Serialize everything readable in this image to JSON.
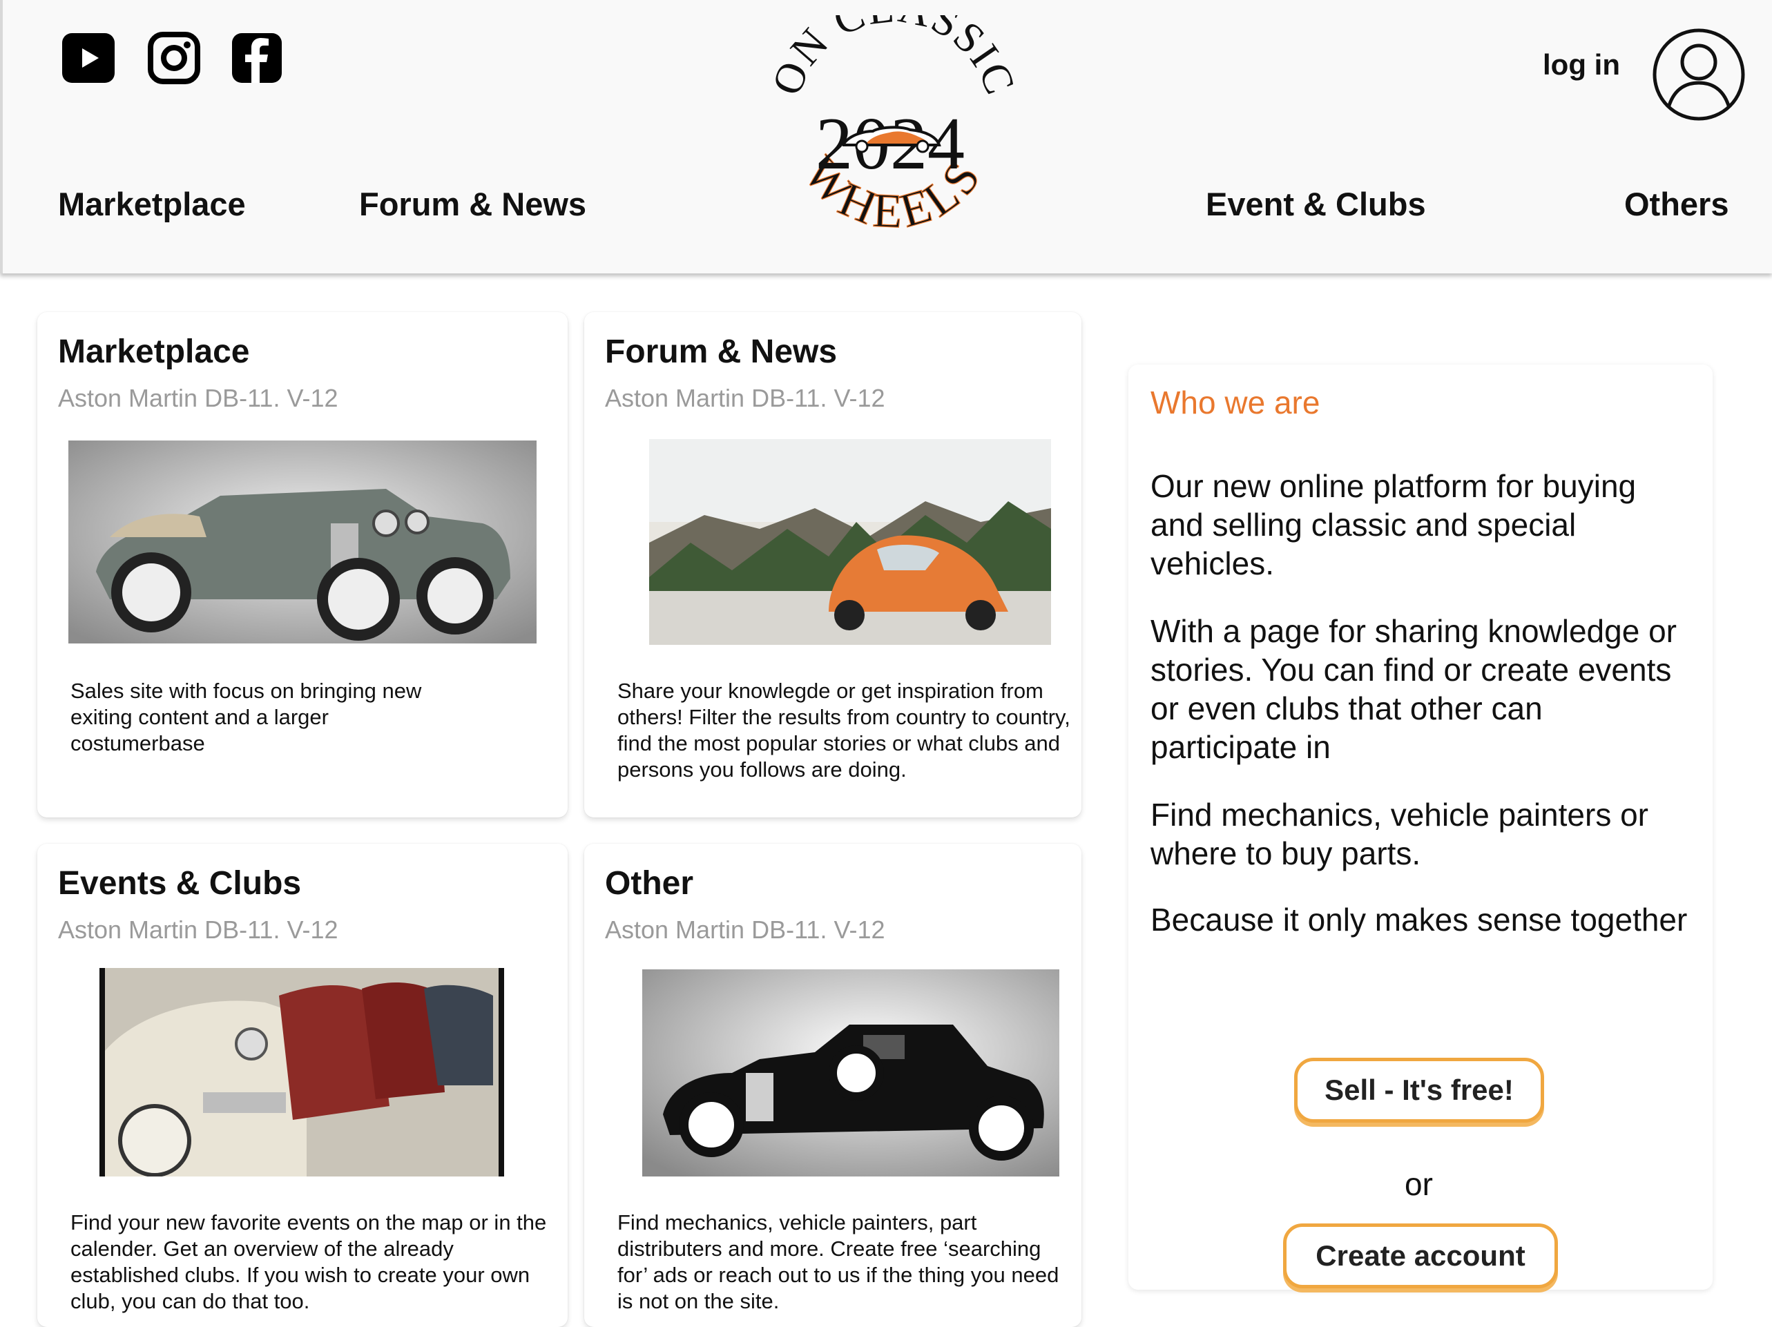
{
  "header": {
    "social": [
      {
        "icon": "youtube-icon"
      },
      {
        "icon": "instagram-icon"
      },
      {
        "icon": "facebook-icon"
      }
    ],
    "logo": {
      "top_text": "ON CLASSIC",
      "year": "2024",
      "bottom_text": "WHEELS"
    },
    "login_label": "log in",
    "nav": {
      "marketplace": "Marketplace",
      "forum": "Forum & News",
      "events": "Event & Clubs",
      "others": "Others"
    }
  },
  "cards": [
    {
      "title": "Marketplace",
      "subtitle": "Aston Martin DB-11. V-12",
      "description": "Sales site with focus on bringing new exiting content and a larger costumerbase"
    },
    {
      "title": "Forum & News",
      "subtitle": "Aston Martin DB-11. V-12",
      "description": "Share your knowlegde or get inspiration from others! Filter the results from country to country, find the most popular stories or what clubs and persons you follows are doing."
    },
    {
      "title": "Events & Clubs",
      "subtitle": "Aston Martin DB-11. V-12",
      "description": "Find your new favorite events on the map or in the calender. Get an overview of the already established clubs. If you wish to create your own club, you can do that too."
    },
    {
      "title": "Other",
      "subtitle": "Aston Martin DB-11. V-12",
      "description": "Find mechanics, vehicle painters, part distributers and more. Create free ‘searching for’ ads or reach out to us if the thing you need is not on the site."
    }
  ],
  "panel": {
    "title": "Who we are",
    "paragraphs": [
      "Our new online platform for buying and selling classic and special vehicles.",
      "With a page for sharing knowledge or stories. You can find or create events or even clubs that other can participate in",
      "Find mechanics, vehicle painters or where to buy parts.",
      "Because it only makes sense together"
    ],
    "sell_label": "Sell - It's free!",
    "or_label": "or",
    "create_label": "Create account"
  },
  "colors": {
    "accent": "#e9782e",
    "button_border": "#f0a740",
    "header_bg": "#f9f9f9",
    "muted": "#9a9a9a"
  }
}
